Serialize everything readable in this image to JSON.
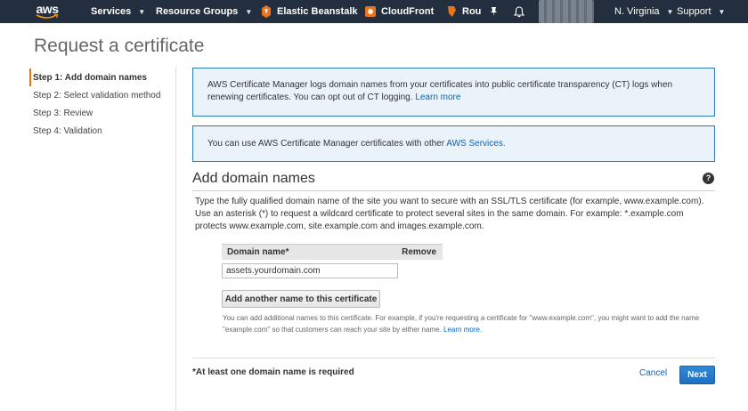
{
  "nav": {
    "logo_text": "aws",
    "services": "Services",
    "resource_groups": "Resource Groups",
    "shortcuts": [
      "Elastic Beanstalk",
      "CloudFront",
      "Rou"
    ],
    "region": "N. Virginia",
    "support": "Support",
    "colors": {
      "background": "#232f3e",
      "beanstalk_icon": "#e8741c",
      "cloudfront_icon": "#e8741c"
    }
  },
  "page": {
    "title": "Request a certificate"
  },
  "steps": [
    {
      "label": "Step 1: Add domain names",
      "active": true
    },
    {
      "label": "Step 2: Select validation method",
      "active": false
    },
    {
      "label": "Step 3: Review",
      "active": false
    },
    {
      "label": "Step 4: Validation",
      "active": false
    }
  ],
  "info": {
    "ct_text": "AWS Certificate Manager logs domain names from your certificates into public certificate transparency (CT) logs when renewing certificates. You can opt out of CT logging.",
    "ct_link": "Learn more",
    "services_text": "You can use AWS Certificate Manager certificates with other",
    "services_link": "AWS Services."
  },
  "section": {
    "title": "Add domain names",
    "description": "Type the fully qualified domain name of the site you want to secure with an SSL/TLS certificate (for example, www.example.com). Use an asterisk (*) to request a wildcard certificate to protect several sites in the same domain. For example: *.example.com protects www.example.com, site.example.com and images.example.com.",
    "table": {
      "col_domain": "Domain name*",
      "col_remove": "Remove"
    },
    "domain_value": "assets.yourdomain.com",
    "add_button": "Add another name to this certificate",
    "hint_text": "You can add additional names to this certificate. For example, if you're requesting a certificate for \"www.example.com\", you might want to add the name \"example.com\" so that customers can reach your site by either name.",
    "hint_link": "Learn more."
  },
  "footer": {
    "required_note": "*At least one domain name is required",
    "cancel": "Cancel",
    "next": "Next"
  }
}
